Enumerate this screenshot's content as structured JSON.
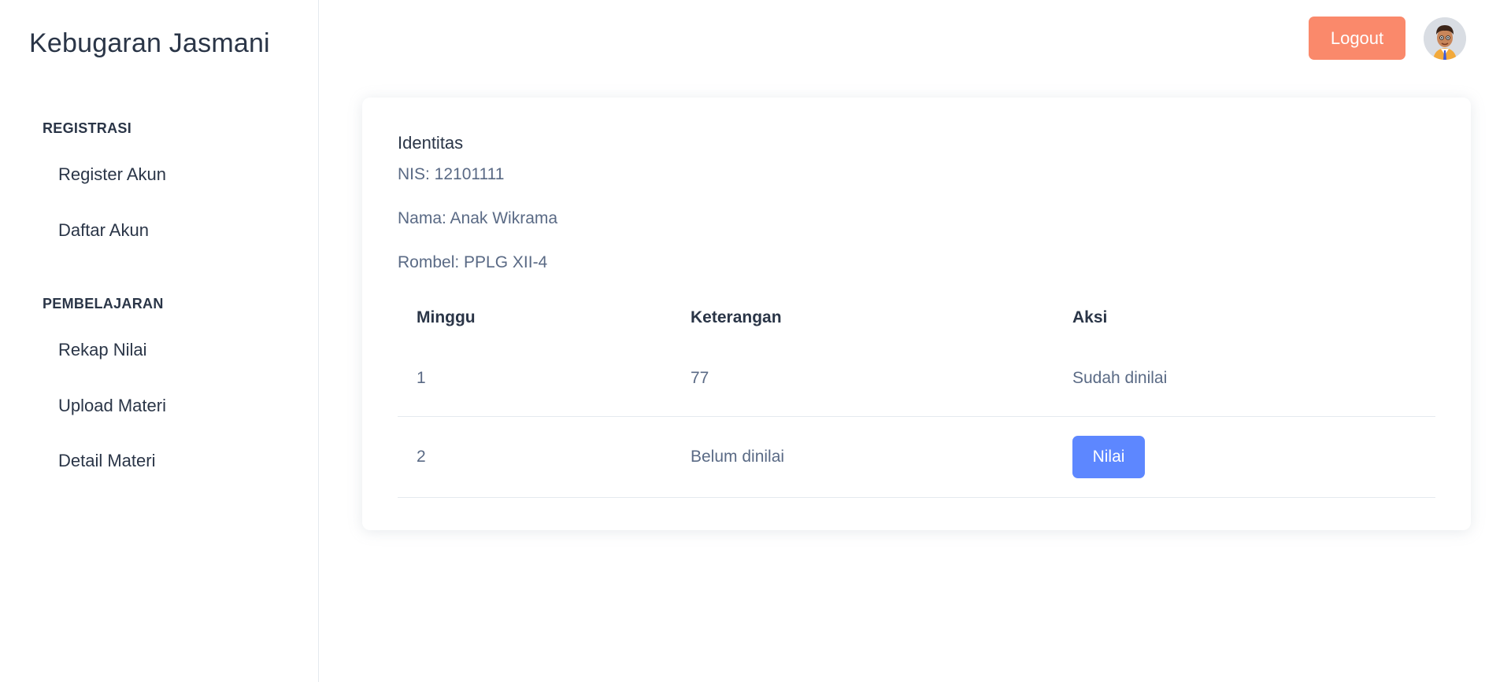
{
  "app": {
    "title": "Kebugaran Jasmani"
  },
  "sidebar": {
    "sections": [
      {
        "label": "REGISTRASI",
        "items": [
          "Register Akun",
          "Daftar Akun"
        ]
      },
      {
        "label": "PEMBELAJARAN",
        "items": [
          "Rekap Nilai",
          "Upload Materi",
          "Detail Materi"
        ]
      }
    ]
  },
  "header": {
    "logout_label": "Logout",
    "avatar_icon": "user-avatar-icon"
  },
  "identity": {
    "title": "Identitas",
    "nis": "NIS: 12101111",
    "nama": "Nama: Anak Wikrama",
    "rombel": "Rombel: PPLG XII-4"
  },
  "table": {
    "headers": [
      "Minggu",
      "Keterangan",
      "Aksi"
    ],
    "rows": [
      {
        "minggu": "1",
        "keterangan": "77",
        "aksi": "Sudah dinilai"
      },
      {
        "minggu": "2",
        "keterangan": "Belum dinilai",
        "aksi_button": "Nilai"
      }
    ]
  },
  "colors": {
    "logout": "#fa896b",
    "primary": "#5d87ff",
    "text": "#2a3547",
    "muted": "#5a6a85"
  }
}
